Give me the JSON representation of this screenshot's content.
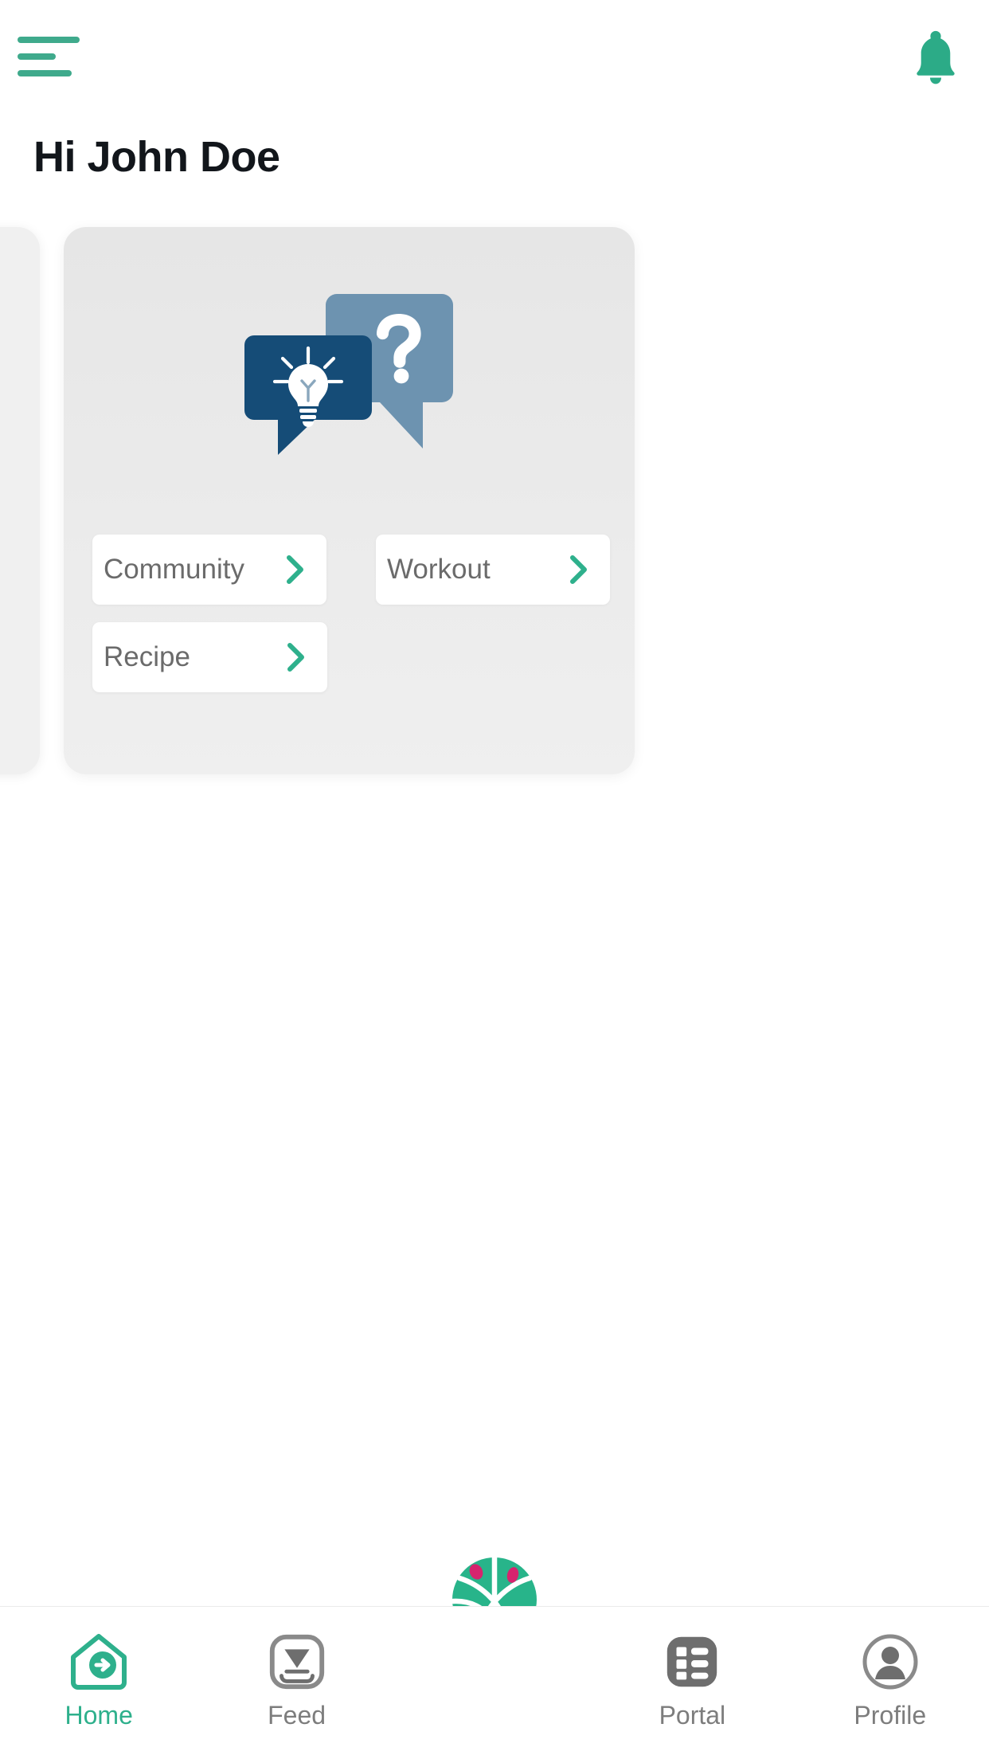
{
  "header": {
    "menu_icon": "hamburger-menu-icon",
    "notification_icon": "bell-icon",
    "accent_color": "#3faa8c"
  },
  "greeting": {
    "text": "Hi John Doe"
  },
  "carousel": {
    "main_card": {
      "illustration": "speech-bubbles-question-lightbulb-illustration",
      "illustration_colors": {
        "back_bubble": "#6d93b0",
        "front_bubble": "#154c77",
        "glyphs": "#ffffff"
      },
      "options": [
        {
          "label": "Community",
          "chevron": "chevron-right-icon"
        },
        {
          "label": "Workout",
          "chevron": "chevron-right-icon"
        },
        {
          "label": "Recipe",
          "chevron": "chevron-right-icon"
        }
      ],
      "chevron_color": "#2eb08c",
      "background_color": "#ececec"
    },
    "peek_card": {
      "background_color": "#f0f0f0"
    }
  },
  "bottom_nav": {
    "items": [
      {
        "label": "Home",
        "icon": "home-arrow-icon",
        "active": true
      },
      {
        "label": "Feed",
        "icon": "inbox-download-icon",
        "active": false
      },
      {
        "label": "Portal",
        "icon": "list-grid-icon",
        "active": false
      },
      {
        "label": "Profile",
        "icon": "user-circle-icon",
        "active": false
      }
    ],
    "center_logo": "basketball-logo-icon",
    "active_color": "#2eb08c",
    "inactive_color": "#7d7d7d",
    "logo_color": "#28b48a",
    "logo_accent_color": "#d6246e"
  }
}
